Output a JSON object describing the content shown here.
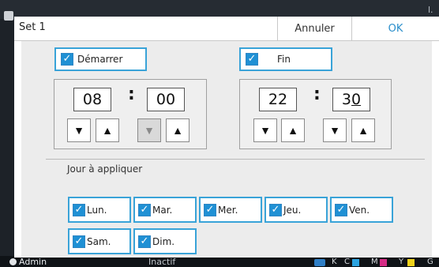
{
  "background": {
    "corner_text": "l.",
    "status": {
      "user": "Admin",
      "state": "Inactif",
      "inks": [
        {
          "label": "K",
          "color": "#222222"
        },
        {
          "label": "C",
          "color": "#2aa3e0"
        },
        {
          "label": "M",
          "color": "#d62b86"
        },
        {
          "label": "Y",
          "color": "#efd21a"
        },
        {
          "label": "G",
          "color": "#8a8a8a"
        }
      ]
    }
  },
  "dialog": {
    "title": "Set 1",
    "cancel_label": "Annuler",
    "ok_label": "OK"
  },
  "start": {
    "label": "Démarrer",
    "checked": true,
    "hour": "08",
    "minute": "00"
  },
  "end": {
    "label": "Fin",
    "checked": true,
    "hour": "22",
    "minute_first": "3",
    "minute_second": "0"
  },
  "arrows": {
    "down": "▼",
    "up": "▲"
  },
  "check_glyph": "✓",
  "colon_glyph": ":",
  "days": {
    "label": "Jour à appliquer",
    "items": [
      {
        "label": "Lun.",
        "checked": true
      },
      {
        "label": "Mar.",
        "checked": true
      },
      {
        "label": "Mer.",
        "checked": true
      },
      {
        "label": "Jeu.",
        "checked": true
      },
      {
        "label": "Ven.",
        "checked": true
      },
      {
        "label": "Sam.",
        "checked": true
      },
      {
        "label": "Dim.",
        "checked": true
      }
    ]
  },
  "colors": {
    "accent": "#39a3d8",
    "checkbox_fill": "#1f90d4",
    "ok_text": "#2a8ecb"
  }
}
